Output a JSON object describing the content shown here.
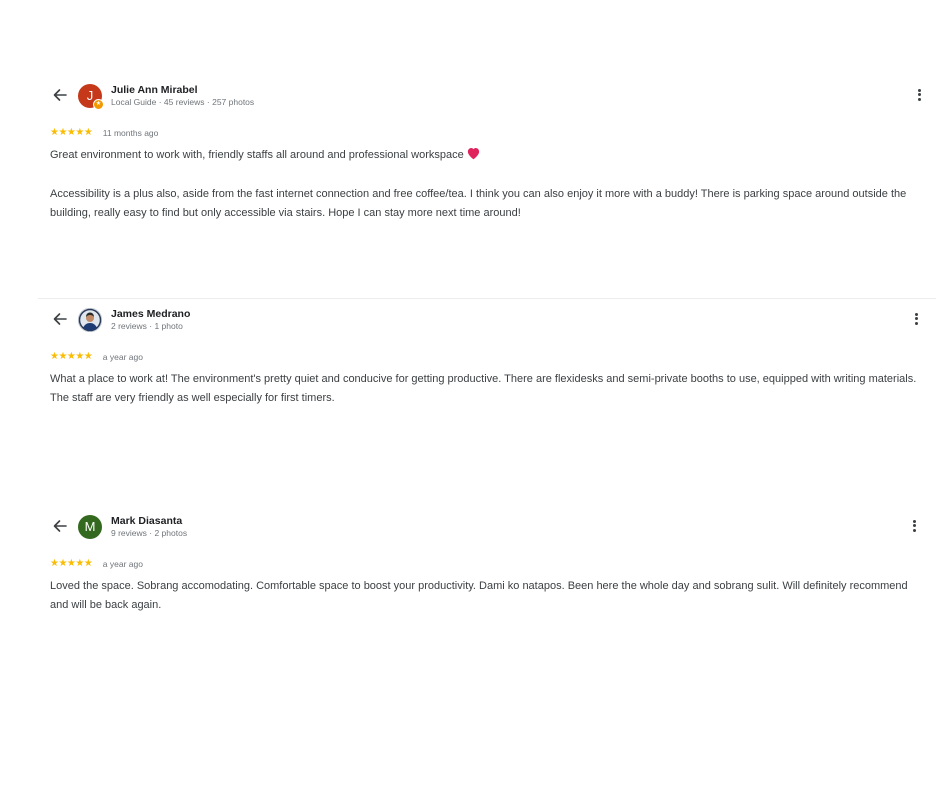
{
  "reviews": [
    {
      "author": "Julie Ann Mirabel",
      "avatar_letter": "J",
      "avatar_color": "#c5391a",
      "meta": "Local Guide · 45 reviews · 257 photos",
      "stars": "★★★★★",
      "rating": 5,
      "age": "11 months ago",
      "paragraph1": "Great environment to work with, friendly staffs all around and professional workspace",
      "emoji": "heart-icon",
      "paragraph2": "Accessibility is a plus also, aside from the fast internet connection and free coffee/tea. I think you can also enjoy it more with a buddy! There is parking space around outside the building, really easy to find but only accessible via stairs. Hope I can stay more next time around!"
    },
    {
      "author": "James Medrano",
      "avatar_color": "#2b3a55",
      "meta": "2 reviews · 1 photo",
      "stars": "★★★★★",
      "rating": 5,
      "age": "a year ago",
      "paragraph1": "What a place to work at! The environment's pretty quiet and conducive for getting productive. There are flexidesks and semi-private booths to use, equipped with writing materials. The staff are very friendly as well especially for first timers."
    },
    {
      "author": "Mark Diasanta",
      "avatar_letter": "M",
      "avatar_color": "#33691e",
      "meta": "9 reviews · 2 photos",
      "stars": "★★★★★",
      "rating": 5,
      "age": "a year ago",
      "paragraph1": "Loved the space. Sobrang accomodating. Comfortable space to boost your productivity. Dami ko natapos. Been here the whole day and sobrang sulit. Will definitely recommend and will be back again."
    }
  ],
  "colors": {
    "star": "#fbbc04",
    "text": "#3c4043",
    "muted": "#70757a"
  }
}
